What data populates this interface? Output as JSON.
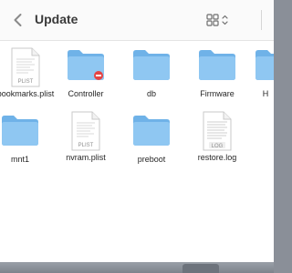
{
  "window": {
    "title": "Update"
  },
  "toolbar": {
    "back_icon": "chevron-left-icon",
    "view_icon": "grid-view-icon"
  },
  "items": [
    {
      "name": "bookmarks.plist",
      "type": "document",
      "badge": "PLIST"
    },
    {
      "name": "Controller",
      "type": "folder",
      "badge": "restricted"
    },
    {
      "name": "db",
      "type": "folder"
    },
    {
      "name": "Firmware",
      "type": "folder"
    },
    {
      "name": "H",
      "type": "folder"
    },
    {
      "name": "mnt1",
      "type": "folder"
    },
    {
      "name": "nvram.plist",
      "type": "document",
      "badge": "PLIST"
    },
    {
      "name": "preboot",
      "type": "folder"
    },
    {
      "name": "restore.log",
      "type": "log",
      "badge": "LOG"
    }
  ],
  "colors": {
    "folder_front": "#8fc7f2",
    "folder_back": "#6fb2e8",
    "restricted_badge": "#e54343"
  }
}
